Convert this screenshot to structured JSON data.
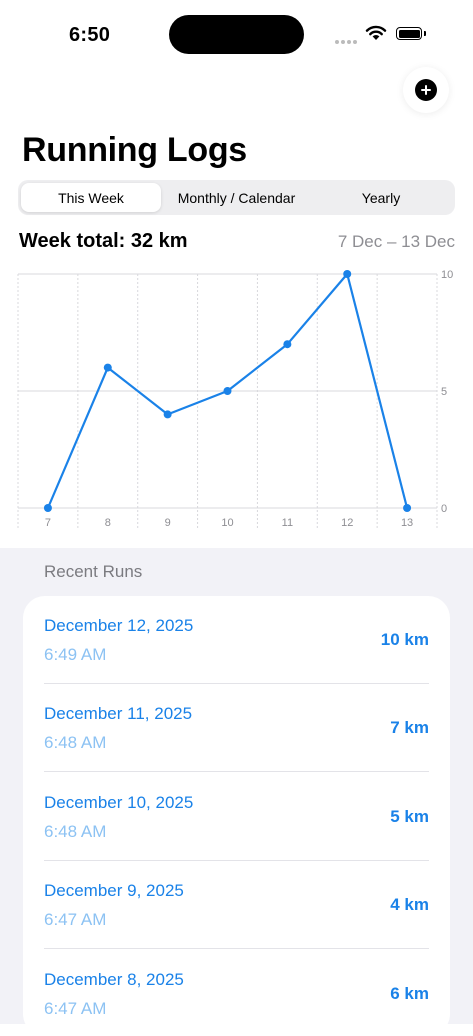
{
  "status": {
    "time": "6:50"
  },
  "header": {
    "title": "Running Logs",
    "add_icon": "plus-circle-icon"
  },
  "tabs": [
    {
      "label": "This Week",
      "active": true
    },
    {
      "label": "Monthly / Calendar",
      "active": false
    },
    {
      "label": "Yearly",
      "active": false
    }
  ],
  "summary": {
    "week_total": "Week total: 32 km",
    "date_range": "7 Dec – 13 Dec"
  },
  "chart_data": {
    "type": "line",
    "x": [
      "7",
      "8",
      "9",
      "10",
      "11",
      "12",
      "13"
    ],
    "values": [
      0,
      6,
      4,
      5,
      7,
      10,
      0
    ],
    "yticks": [
      "0",
      "5",
      "10"
    ],
    "ylim": [
      0,
      10
    ],
    "grid": true,
    "color": "#1a82e8"
  },
  "recent": {
    "header": "Recent Runs",
    "runs": [
      {
        "date": "December 12, 2025",
        "time": "6:49 AM",
        "distance": "10 km"
      },
      {
        "date": "December 11, 2025",
        "time": "6:48 AM",
        "distance": "7 km"
      },
      {
        "date": "December 10, 2025",
        "time": "6:48 AM",
        "distance": "5 km"
      },
      {
        "date": "December 9, 2025",
        "time": "6:47 AM",
        "distance": "4 km"
      },
      {
        "date": "December 8, 2025",
        "time": "6:47 AM",
        "distance": "6 km"
      }
    ]
  },
  "colors": {
    "accent": "#1a82e8",
    "accent_light": "#8cc2f3",
    "secondary_text": "#8e8e93",
    "grouped_bg": "#f2f2f7"
  }
}
